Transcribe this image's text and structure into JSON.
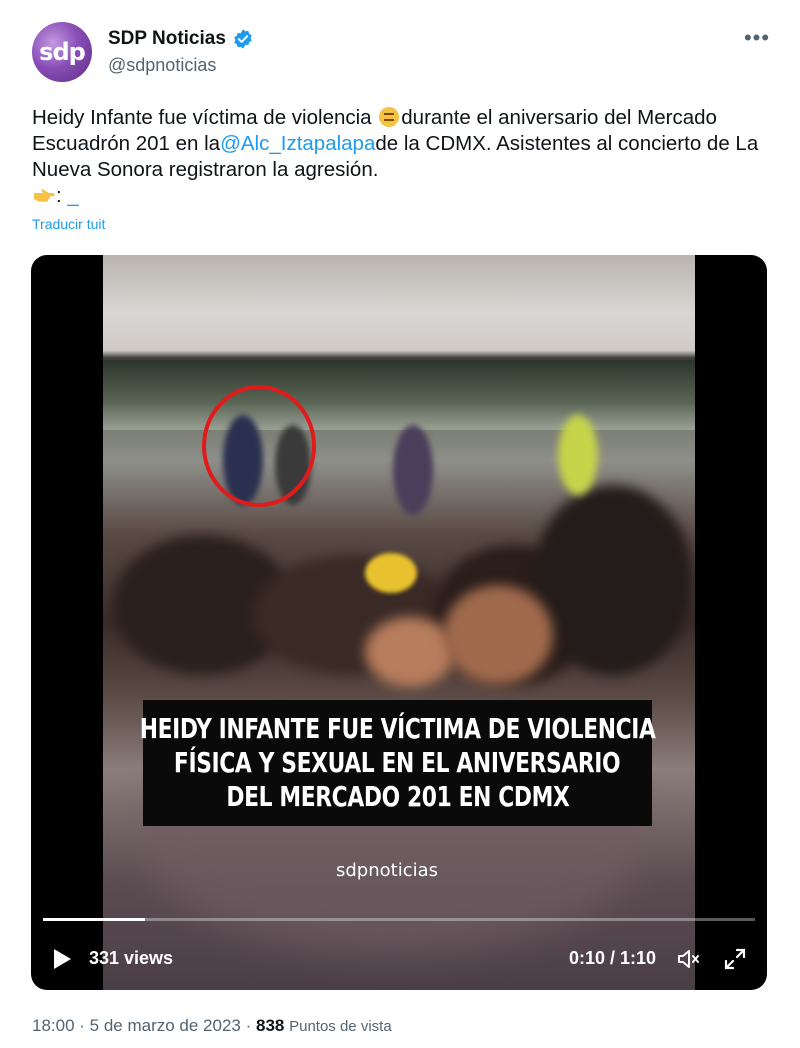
{
  "author": {
    "avatar_text": "sdp",
    "display_name": "SDP Noticias",
    "handle": "@sdpnoticias"
  },
  "tweet": {
    "text_part1": "Heidy Infante fue víctima de violencia ",
    "text_part2": "durante el aniversario del Mercado Escuadrón 201 en la",
    "mention": "@Alc_Iztapalapa",
    "text_part3": "de la CDMX. Asistentes al concierto de La Nueva Sonora registraron la agresión.",
    "link_prefix": ": ",
    "link_text": "_",
    "translate_label": "Traducir tuit"
  },
  "video": {
    "caption_lines": [
      "HEIDY INFANTE FUE VÍCTIMA DE VIOLENCIA",
      "FÍSICA Y SEXUAL EN EL ANIVERSARIO",
      "DEL MERCADO 201 EN CDMX"
    ],
    "watermark": "sdpnoticias",
    "views": "331 views",
    "time": "0:10 / 1:10",
    "progress_fraction": 0.143
  },
  "meta": {
    "time": "18:00",
    "separator": " · ",
    "date": "5 de marzo de 2023",
    "views_count": "838",
    "views_label": "Puntos de vista"
  },
  "colors": {
    "accent": "#1d9bf0",
    "verified": "#1d9bf0",
    "annotation_circle": "#e01b1b"
  }
}
